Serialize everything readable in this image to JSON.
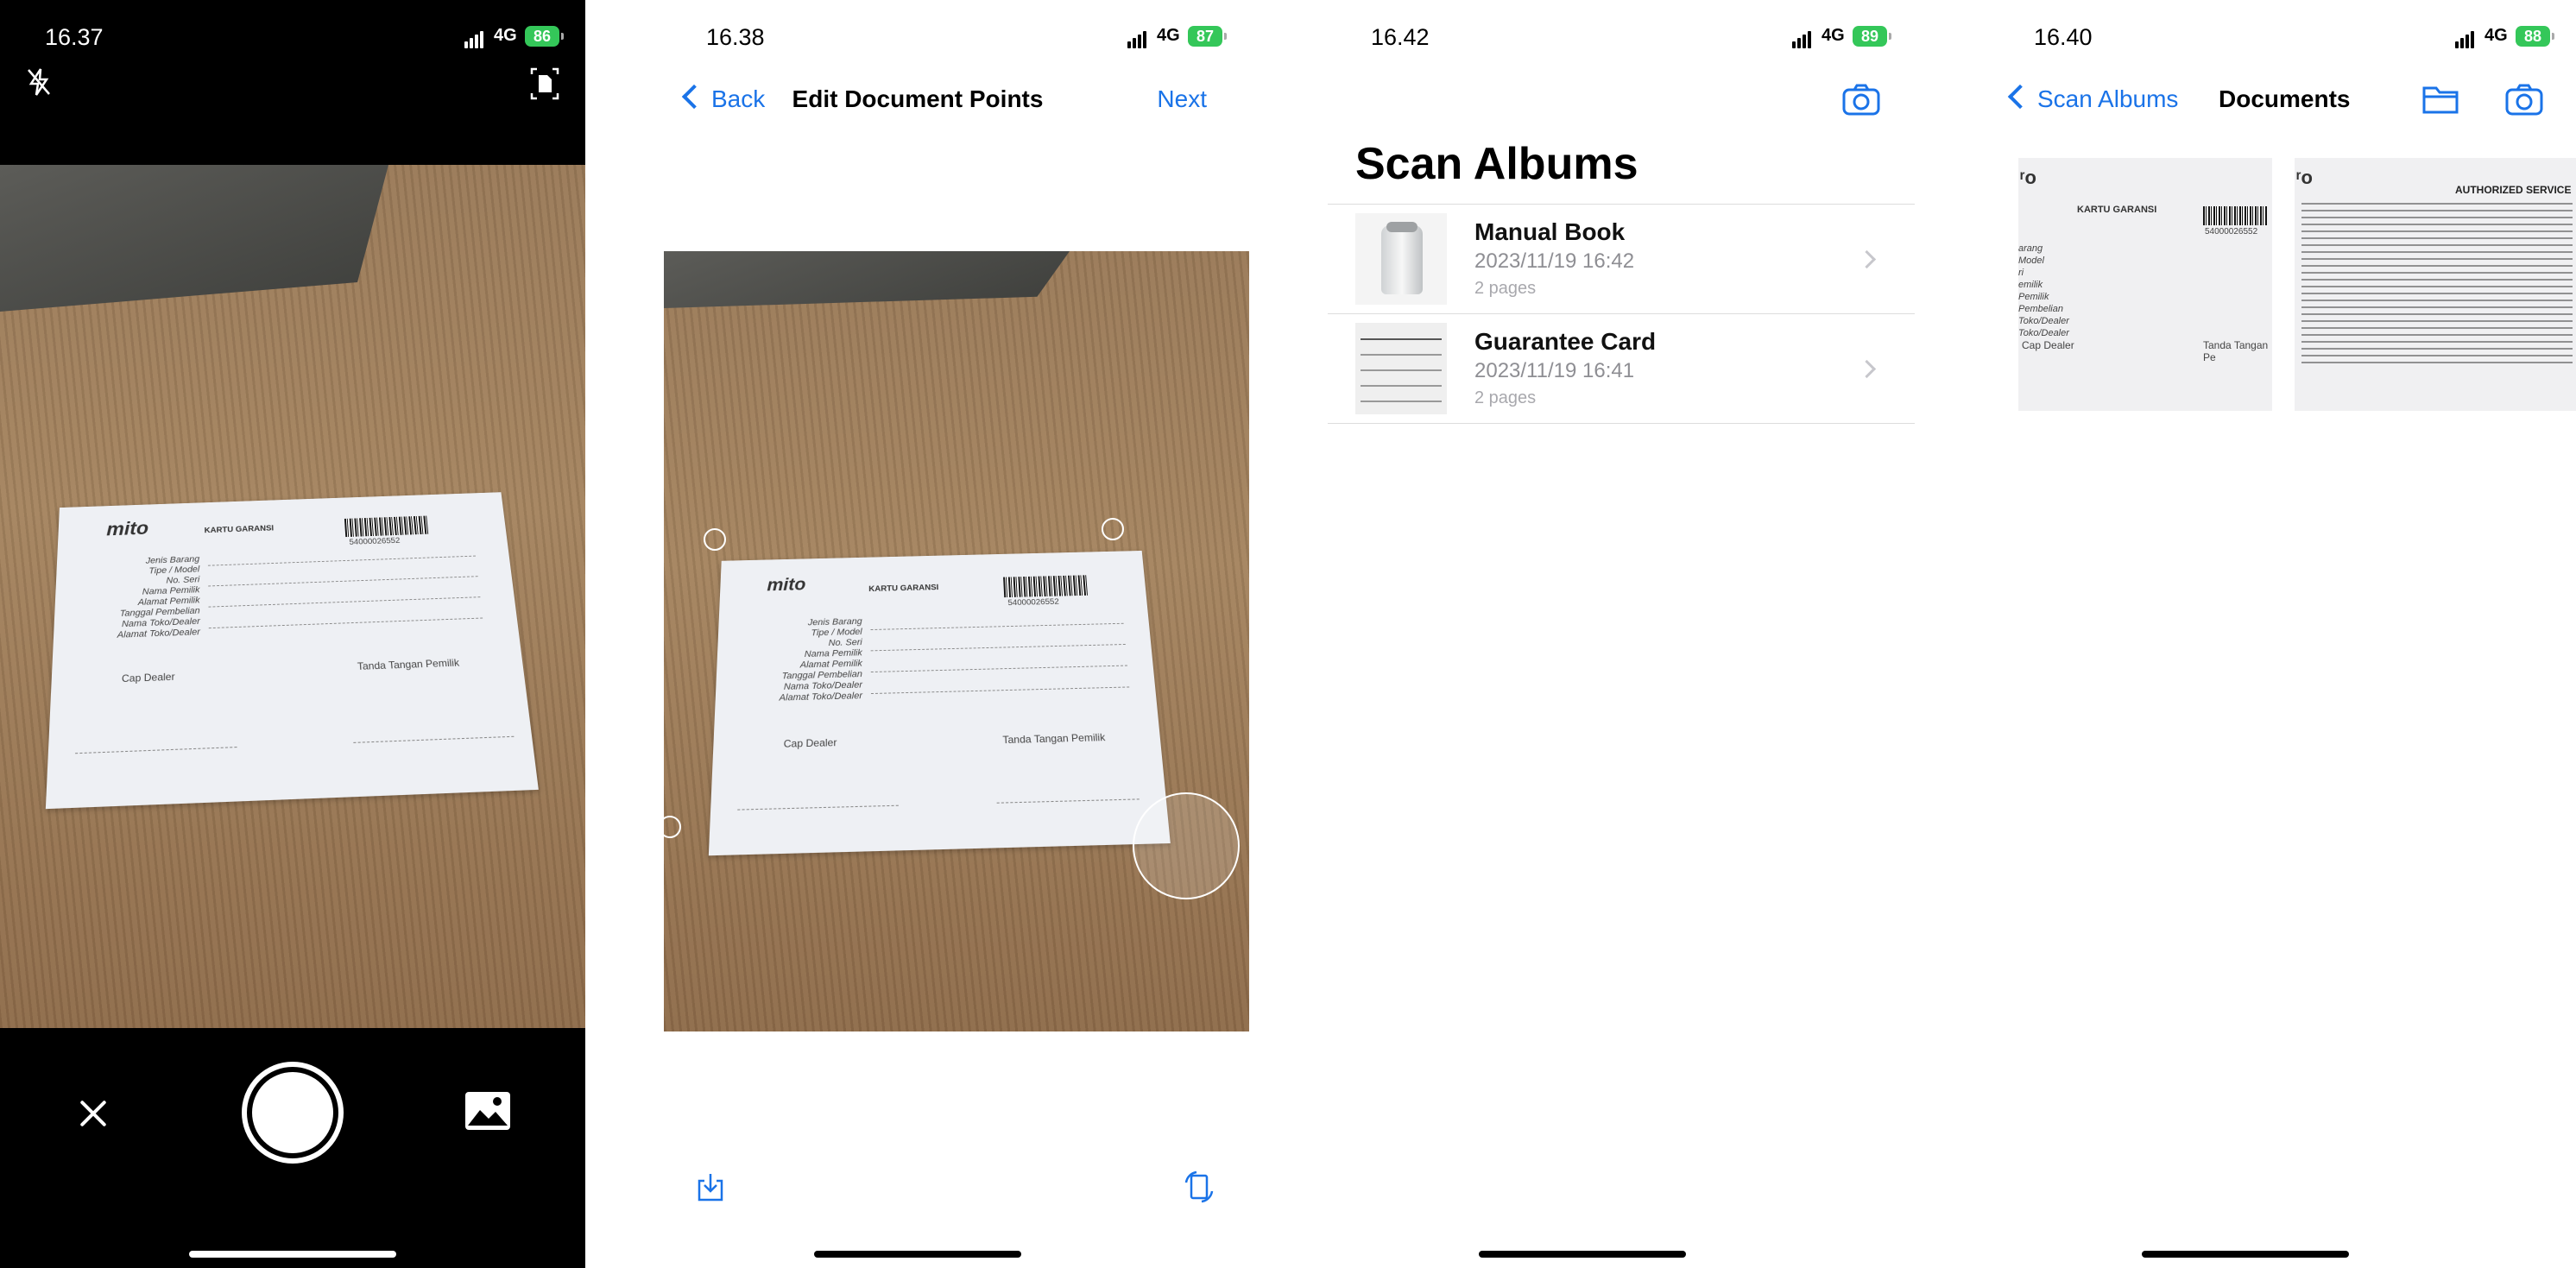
{
  "screen1": {
    "status": {
      "time": "16.37",
      "network": "4G",
      "battery": "86"
    },
    "card": {
      "logo": "mito",
      "title": "KARTU GARANSI",
      "barcode": "54000026552",
      "fields": [
        "Jenis Barang",
        "Tipe / Model",
        "No. Seri",
        "Nama Pemilik",
        "Alamat Pemilik",
        "Tanggal Pembelian",
        "Nama Toko/Dealer",
        "Alamat Toko/Dealer"
      ],
      "cap": "Cap Dealer",
      "sign": "Tanda Tangan Pemilik"
    },
    "icons": {
      "flash": "flash-off-icon",
      "scan_mode": "document-scan-icon",
      "close": "close-icon",
      "shutter": "shutter-button",
      "gallery": "photo-gallery-icon"
    }
  },
  "screen2": {
    "status": {
      "time": "16.38",
      "network": "4G",
      "battery": "87"
    },
    "nav": {
      "back": "Back",
      "title": "Edit Document Points",
      "next": "Next"
    },
    "card": {
      "logo": "mito",
      "title": "KARTU GARANSI",
      "barcode": "54000026552",
      "fields": [
        "Jenis Barang",
        "Tipe / Model",
        "No. Seri",
        "Nama Pemilik",
        "Alamat Pemilik",
        "Tanggal Pembelian",
        "Nama Toko/Dealer",
        "Alamat Toko/Dealer"
      ],
      "cap": "Cap Dealer",
      "sign": "Tanda Tangan Pemilik"
    },
    "icons": {
      "save": "download-icon",
      "rotate": "rotate-icon"
    }
  },
  "screen3": {
    "status": {
      "time": "16.42",
      "network": "4G",
      "battery": "89"
    },
    "title": "Scan Albums",
    "albums": [
      {
        "name": "Manual Book",
        "date": "2023/11/19 16:42",
        "pages": "2 pages"
      },
      {
        "name": "Guarantee Card",
        "date": "2023/11/19 16:41",
        "pages": "2 pages"
      }
    ],
    "icons": {
      "camera": "camera-icon"
    }
  },
  "screen4": {
    "status": {
      "time": "16.40",
      "network": "4G",
      "battery": "88"
    },
    "nav": {
      "back": "Scan Albums",
      "title": "Documents"
    },
    "thumbs": [
      {
        "title": "KARTU GARANSI",
        "barcode": "54000026552",
        "fields": [
          "arang",
          "Model",
          "ri",
          "emilik",
          "Pemilik",
          "Pembelian",
          "Toko/Dealer",
          "Toko/Dealer"
        ],
        "cap": "Cap Dealer",
        "sign": "Tanda Tangan Pe"
      },
      {
        "title": "AUTHORIZED SERVICE"
      }
    ],
    "icons": {
      "folder": "folder-icon",
      "camera": "camera-icon"
    }
  }
}
